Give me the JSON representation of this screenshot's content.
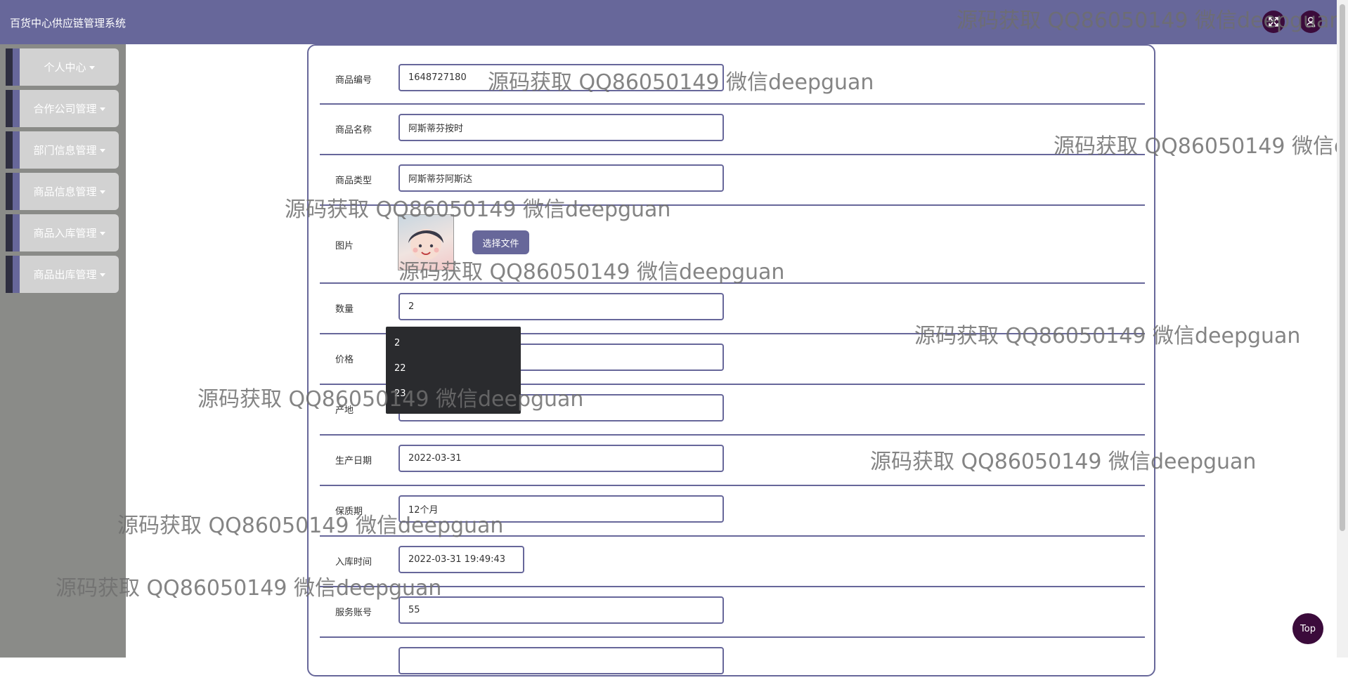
{
  "header": {
    "title": "百货中心供应链管理系统"
  },
  "sidebar": {
    "items": [
      {
        "label": "个人中心"
      },
      {
        "label": "合作公司管理"
      },
      {
        "label": "部门信息管理"
      },
      {
        "label": "商品信息管理"
      },
      {
        "label": "商品入库管理"
      },
      {
        "label": "商品出库管理"
      }
    ]
  },
  "form": {
    "code": {
      "label": "商品编号",
      "value": "1648727180"
    },
    "name": {
      "label": "商品名称",
      "value": "阿斯蒂芬按时"
    },
    "type": {
      "label": "商品类型",
      "value": "阿斯蒂芬阿斯达"
    },
    "image": {
      "label": "图片",
      "button": "选择文件"
    },
    "qty": {
      "label": "数量",
      "value": "2"
    },
    "price": {
      "label": "价格",
      "value": ""
    },
    "origin": {
      "label": "产地",
      "value": "广地"
    },
    "prod_date": {
      "label": "生产日期",
      "value": "2022-03-31"
    },
    "shelf": {
      "label": "保质期",
      "value": "12个月"
    },
    "in_time": {
      "label": "入库时间",
      "value": "2022-03-31 19:49:43"
    },
    "account": {
      "label": "服务账号",
      "value": "55"
    }
  },
  "autocomplete": {
    "options": [
      "2",
      "22",
      "23"
    ]
  },
  "watermark": "源码获取 QQ86050149 微信deepguan",
  "back_to_top": "Top",
  "colors": {
    "accent": "#67679a",
    "sidebar_bg": "#8a8b88",
    "dark_button": "#3b0b3b"
  },
  "icons": {
    "fullscreen": "expand-icon",
    "user": "user-icon"
  }
}
